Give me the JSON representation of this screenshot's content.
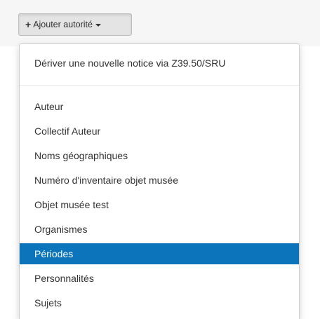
{
  "toolbar": {
    "add_button": {
      "icon": "plus-icon",
      "label": "Ajouter autorité",
      "caret": "caret-down-icon"
    }
  },
  "menu": {
    "derive_item": "Dériver une nouvelle notice via Z39.50/SRU",
    "items": [
      "Auteur",
      "Collectif Auteur",
      "Noms géographiques",
      "Numéro d'inventaire objet musée",
      "Objet musée test",
      "Organismes",
      "Périodes",
      "Personnalités",
      "Sujets"
    ],
    "active_item": "Périodes",
    "highlight_color": "#0b74ba"
  }
}
